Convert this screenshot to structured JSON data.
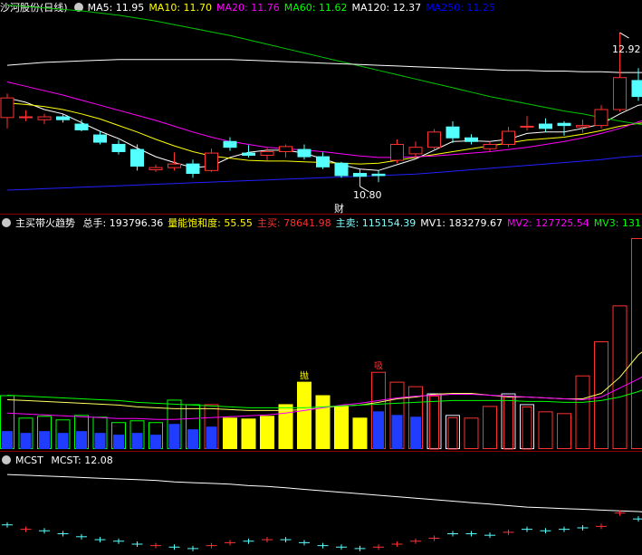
{
  "price_panel": {
    "name": "沙河股份(日线)",
    "ma": [
      {
        "label": "MA5: 11.95",
        "color": "#ffffff"
      },
      {
        "label": "MA10: 11.70",
        "color": "#ffff00"
      },
      {
        "label": "MA20: 11.76",
        "color": "#ff00ff"
      },
      {
        "label": "MA60: 11.62",
        "color": "#00ff00"
      },
      {
        "label": "MA120: 12.37",
        "color": "#ffffff"
      },
      {
        "label": "MA250: 11.25",
        "color": "#0000ff"
      }
    ],
    "high_label": "12.92",
    "low_label": "10.80",
    "event_label": "财",
    "candles": [
      {
        "o": 11.75,
        "h": 12.08,
        "l": 11.6,
        "c": 12.02
      },
      {
        "o": 11.76,
        "h": 11.85,
        "l": 11.7,
        "c": 11.76
      },
      {
        "o": 11.72,
        "h": 11.8,
        "l": 11.66,
        "c": 11.76
      },
      {
        "o": 11.76,
        "h": 11.8,
        "l": 11.68,
        "c": 11.72
      },
      {
        "o": 11.66,
        "h": 11.72,
        "l": 11.56,
        "c": 11.58
      },
      {
        "o": 11.51,
        "h": 11.56,
        "l": 11.38,
        "c": 11.41
      },
      {
        "o": 11.38,
        "h": 11.44,
        "l": 11.24,
        "c": 11.28
      },
      {
        "o": 11.31,
        "h": 11.38,
        "l": 11.02,
        "c": 11.08
      },
      {
        "o": 11.03,
        "h": 11.1,
        "l": 11.0,
        "c": 11.06
      },
      {
        "o": 11.06,
        "h": 11.27,
        "l": 11.02,
        "c": 11.11
      },
      {
        "o": 11.11,
        "h": 11.17,
        "l": 10.92,
        "c": 10.98
      },
      {
        "o": 11.02,
        "h": 11.32,
        "l": 11.0,
        "c": 11.26
      },
      {
        "o": 11.42,
        "h": 11.48,
        "l": 11.29,
        "c": 11.34
      },
      {
        "o": 11.26,
        "h": 11.37,
        "l": 11.2,
        "c": 11.23
      },
      {
        "o": 11.23,
        "h": 11.33,
        "l": 11.16,
        "c": 11.28
      },
      {
        "o": 11.28,
        "h": 11.38,
        "l": 11.2,
        "c": 11.35
      },
      {
        "o": 11.31,
        "h": 11.38,
        "l": 11.17,
        "c": 11.21
      },
      {
        "o": 11.21,
        "h": 11.27,
        "l": 11.04,
        "c": 11.07
      },
      {
        "o": 11.12,
        "h": 11.14,
        "l": 10.92,
        "c": 10.95
      },
      {
        "o": 10.98,
        "h": 11.04,
        "l": 10.8,
        "c": 10.94
      },
      {
        "o": 10.97,
        "h": 11.02,
        "l": 10.86,
        "c": 10.95
      },
      {
        "o": 11.16,
        "h": 11.45,
        "l": 11.12,
        "c": 11.38
      },
      {
        "o": 11.25,
        "h": 11.42,
        "l": 11.2,
        "c": 11.34
      },
      {
        "o": 11.34,
        "h": 11.59,
        "l": 11.3,
        "c": 11.55
      },
      {
        "o": 11.62,
        "h": 11.7,
        "l": 11.4,
        "c": 11.47
      },
      {
        "o": 11.47,
        "h": 11.52,
        "l": 11.38,
        "c": 11.42
      },
      {
        "o": 11.32,
        "h": 11.42,
        "l": 11.28,
        "c": 11.38
      },
      {
        "o": 11.38,
        "h": 11.62,
        "l": 11.34,
        "c": 11.56
      },
      {
        "o": 11.63,
        "h": 11.77,
        "l": 11.57,
        "c": 11.63
      },
      {
        "o": 11.66,
        "h": 11.74,
        "l": 11.55,
        "c": 11.6
      },
      {
        "o": 11.67,
        "h": 11.7,
        "l": 11.5,
        "c": 11.64
      },
      {
        "o": 11.62,
        "h": 11.72,
        "l": 11.54,
        "c": 11.64
      },
      {
        "o": 11.64,
        "h": 11.92,
        "l": 11.6,
        "c": 11.86
      },
      {
        "o": 11.86,
        "h": 12.92,
        "l": 11.83,
        "c": 12.3
      },
      {
        "o": 12.26,
        "h": 12.43,
        "l": 11.98,
        "c": 12.04
      },
      {
        "o": 12.04,
        "h": 12.38,
        "l": 11.94,
        "c": 12.26
      }
    ],
    "ma_series": {
      "MA5": [
        12.02,
        11.96,
        11.86,
        11.8,
        11.68,
        11.56,
        11.46,
        11.33,
        11.21,
        11.13,
        11.06,
        11.08,
        11.2,
        11.27,
        11.3,
        11.3,
        11.26,
        11.18,
        11.1,
        11.04,
        11.02,
        11.1,
        11.18,
        11.3,
        11.42,
        11.43,
        11.42,
        11.45,
        11.53,
        11.55,
        11.55,
        11.6,
        11.66,
        11.8,
        11.92,
        11.95
      ],
      "MA10": [
        11.95,
        11.93,
        11.9,
        11.86,
        11.8,
        11.73,
        11.64,
        11.55,
        11.45,
        11.36,
        11.28,
        11.22,
        11.19,
        11.16,
        11.15,
        11.15,
        11.14,
        11.13,
        11.12,
        11.11,
        11.12,
        11.16,
        11.2,
        11.24,
        11.28,
        11.32,
        11.36,
        11.4,
        11.44,
        11.46,
        11.48,
        11.52,
        11.57,
        11.63,
        11.67,
        11.7
      ],
      "MA20": [
        12.24,
        12.18,
        12.12,
        12.06,
        11.99,
        11.92,
        11.85,
        11.78,
        11.71,
        11.63,
        11.55,
        11.48,
        11.42,
        11.38,
        11.34,
        11.32,
        11.3,
        11.28,
        11.25,
        11.22,
        11.2,
        11.2,
        11.21,
        11.22,
        11.24,
        11.26,
        11.28,
        11.31,
        11.34,
        11.38,
        11.42,
        11.47,
        11.53,
        11.6,
        11.69,
        11.76
      ],
      "MA60": [
        13.3,
        13.28,
        13.26,
        13.24,
        13.22,
        13.19,
        13.16,
        13.12,
        13.08,
        13.03,
        12.98,
        12.93,
        12.88,
        12.82,
        12.76,
        12.7,
        12.64,
        12.58,
        12.52,
        12.46,
        12.4,
        12.34,
        12.28,
        12.22,
        12.16,
        12.1,
        12.04,
        11.99,
        11.94,
        11.89,
        11.84,
        11.8,
        11.75,
        11.7,
        11.66,
        11.62
      ],
      "MA120": [
        12.47,
        12.49,
        12.51,
        12.52,
        12.53,
        12.54,
        12.55,
        12.55,
        12.55,
        12.55,
        12.55,
        12.55,
        12.55,
        12.54,
        12.53,
        12.52,
        12.51,
        12.5,
        12.49,
        12.48,
        12.47,
        12.46,
        12.45,
        12.44,
        12.43,
        12.42,
        12.41,
        12.4,
        12.4,
        12.39,
        12.39,
        12.38,
        12.38,
        12.37,
        12.37,
        12.37
      ],
      "MA250": [
        10.75,
        10.76,
        10.77,
        10.78,
        10.79,
        10.8,
        10.81,
        10.82,
        10.83,
        10.84,
        10.85,
        10.86,
        10.87,
        10.88,
        10.89,
        10.9,
        10.91,
        10.92,
        10.93,
        10.94,
        10.95,
        10.96,
        10.97,
        10.99,
        11.01,
        11.03,
        11.05,
        11.07,
        11.09,
        11.11,
        11.13,
        11.15,
        11.17,
        11.2,
        11.22,
        11.25
      ]
    }
  },
  "volume_panel": {
    "title": "主买带火趋势",
    "items": [
      {
        "label": "总手: 193796.36",
        "color": "#ffffff"
      },
      {
        "label": "量能饱和度: 55.55",
        "color": "#ffff00"
      },
      {
        "label": "主买: 78641.98",
        "color": "#ff3030"
      },
      {
        "label": "主卖: 115154.39",
        "color": "#7fffff"
      },
      {
        "label": "MV1: 183279.67",
        "color": "#ffffff"
      },
      {
        "label": "MV2: 127725.54",
        "color": "#ff00ff"
      },
      {
        "label": "MV3: 131",
        "color": "#00ff00"
      }
    ],
    "markers": [
      {
        "label": "抛",
        "color": "#ffff00",
        "bar": 16
      },
      {
        "label": "吸",
        "color": "#ff3030",
        "bar": 20
      }
    ],
    "bars": [
      {
        "v": 60,
        "s": "g",
        "b": 20
      },
      {
        "v": 35,
        "s": "g",
        "b": 18
      },
      {
        "v": 37,
        "s": "g",
        "b": 20
      },
      {
        "v": 33,
        "s": "g",
        "b": 18
      },
      {
        "v": 38,
        "s": "g",
        "b": 20
      },
      {
        "v": 36,
        "s": "g",
        "b": 18
      },
      {
        "v": 30,
        "s": "g",
        "b": 16
      },
      {
        "v": 32,
        "s": "g",
        "b": 18
      },
      {
        "v": 30,
        "s": "g",
        "b": 16
      },
      {
        "v": 55,
        "s": "g",
        "b": 28
      },
      {
        "v": 50,
        "s": "g",
        "b": 22
      },
      {
        "v": 50,
        "s": "r",
        "b": 25
      },
      {
        "v": 35,
        "s": "y"
      },
      {
        "v": 34,
        "s": "y"
      },
      {
        "v": 37,
        "s": "y"
      },
      {
        "v": 50,
        "s": "y"
      },
      {
        "v": 75,
        "s": "y"
      },
      {
        "v": 60,
        "s": "y"
      },
      {
        "v": 48,
        "s": "y"
      },
      {
        "v": 35,
        "s": "y"
      },
      {
        "v": 86,
        "s": "r",
        "b": 42
      },
      {
        "v": 75,
        "s": "r",
        "b": 38
      },
      {
        "v": 70,
        "s": "r",
        "b": 36
      },
      {
        "v": 62,
        "s": "w"
      },
      {
        "v": 38,
        "s": "w"
      },
      {
        "v": 35,
        "s": "r"
      },
      {
        "v": 48,
        "s": "r"
      },
      {
        "v": 62,
        "s": "w"
      },
      {
        "v": 50,
        "s": "w"
      },
      {
        "v": 42,
        "s": "r"
      },
      {
        "v": 40,
        "s": "r"
      },
      {
        "v": 82,
        "s": "r"
      },
      {
        "v": 120,
        "s": "r"
      },
      {
        "v": 160,
        "s": "r"
      },
      {
        "v": 235,
        "s": "r"
      },
      {
        "v": 200,
        "s": "r"
      }
    ],
    "mv1": [
      55,
      54,
      53,
      52,
      51,
      50,
      49,
      47,
      46,
      45,
      45,
      45,
      44,
      43,
      43,
      43,
      44,
      46,
      48,
      49,
      52,
      56,
      58,
      61,
      62,
      62,
      60,
      58,
      58,
      57,
      56,
      56,
      62,
      80,
      105,
      120
    ],
    "mv2": [
      40,
      39,
      38,
      37,
      36,
      35,
      34,
      34,
      33,
      33,
      34,
      35,
      36,
      37,
      38,
      40,
      43,
      46,
      49,
      51,
      54,
      57,
      59,
      60,
      61,
      61,
      60,
      59,
      58,
      57,
      56,
      55,
      58,
      68,
      78,
      90
    ],
    "mv3": [
      60,
      59,
      58,
      57,
      56,
      55,
      54,
      52,
      51,
      50,
      49,
      48,
      47,
      46,
      46,
      46,
      46,
      47,
      48,
      49,
      50,
      51,
      52,
      53,
      54,
      54,
      54,
      54,
      53,
      53,
      52,
      52,
      54,
      58,
      64,
      72
    ]
  },
  "mcst_panel": {
    "title": "MCST",
    "value_label": "MCST: 12.08",
    "mcst_line": [
      12.6,
      12.59,
      12.58,
      12.57,
      12.56,
      12.55,
      12.54,
      12.53,
      12.52,
      12.5,
      12.49,
      12.48,
      12.47,
      12.45,
      12.44,
      12.42,
      12.4,
      12.38,
      12.36,
      12.34,
      12.32,
      12.3,
      12.28,
      12.26,
      12.24,
      12.22,
      12.2,
      12.18,
      12.16,
      12.15,
      12.14,
      12.13,
      12.12,
      12.11,
      12.1,
      12.08
    ],
    "ticks": [
      {
        "v": 11.92,
        "c": "c"
      },
      {
        "v": 11.86,
        "c": "r"
      },
      {
        "v": 11.84,
        "c": "c"
      },
      {
        "v": 11.8,
        "c": "c"
      },
      {
        "v": 11.76,
        "c": "c"
      },
      {
        "v": 11.72,
        "c": "c"
      },
      {
        "v": 11.7,
        "c": "c"
      },
      {
        "v": 11.66,
        "c": "c"
      },
      {
        "v": 11.64,
        "c": "r"
      },
      {
        "v": 11.62,
        "c": "c"
      },
      {
        "v": 11.6,
        "c": "c"
      },
      {
        "v": 11.64,
        "c": "r"
      },
      {
        "v": 11.68,
        "c": "r"
      },
      {
        "v": 11.7,
        "c": "c"
      },
      {
        "v": 11.72,
        "c": "r"
      },
      {
        "v": 11.72,
        "c": "c"
      },
      {
        "v": 11.68,
        "c": "c"
      },
      {
        "v": 11.64,
        "c": "c"
      },
      {
        "v": 11.62,
        "c": "c"
      },
      {
        "v": 11.6,
        "c": "c"
      },
      {
        "v": 11.62,
        "c": "r"
      },
      {
        "v": 11.66,
        "c": "r"
      },
      {
        "v": 11.7,
        "c": "r"
      },
      {
        "v": 11.74,
        "c": "r"
      },
      {
        "v": 11.8,
        "c": "c"
      },
      {
        "v": 11.8,
        "c": "c"
      },
      {
        "v": 11.78,
        "c": "c"
      },
      {
        "v": 11.82,
        "c": "r"
      },
      {
        "v": 11.86,
        "c": "c"
      },
      {
        "v": 11.84,
        "c": "c"
      },
      {
        "v": 11.86,
        "c": "c"
      },
      {
        "v": 11.88,
        "c": "c"
      },
      {
        "v": 11.9,
        "c": "r"
      },
      {
        "v": 12.08,
        "c": "r"
      },
      {
        "v": 12.0,
        "c": "c"
      },
      {
        "v": 12.04,
        "c": "c"
      }
    ]
  }
}
